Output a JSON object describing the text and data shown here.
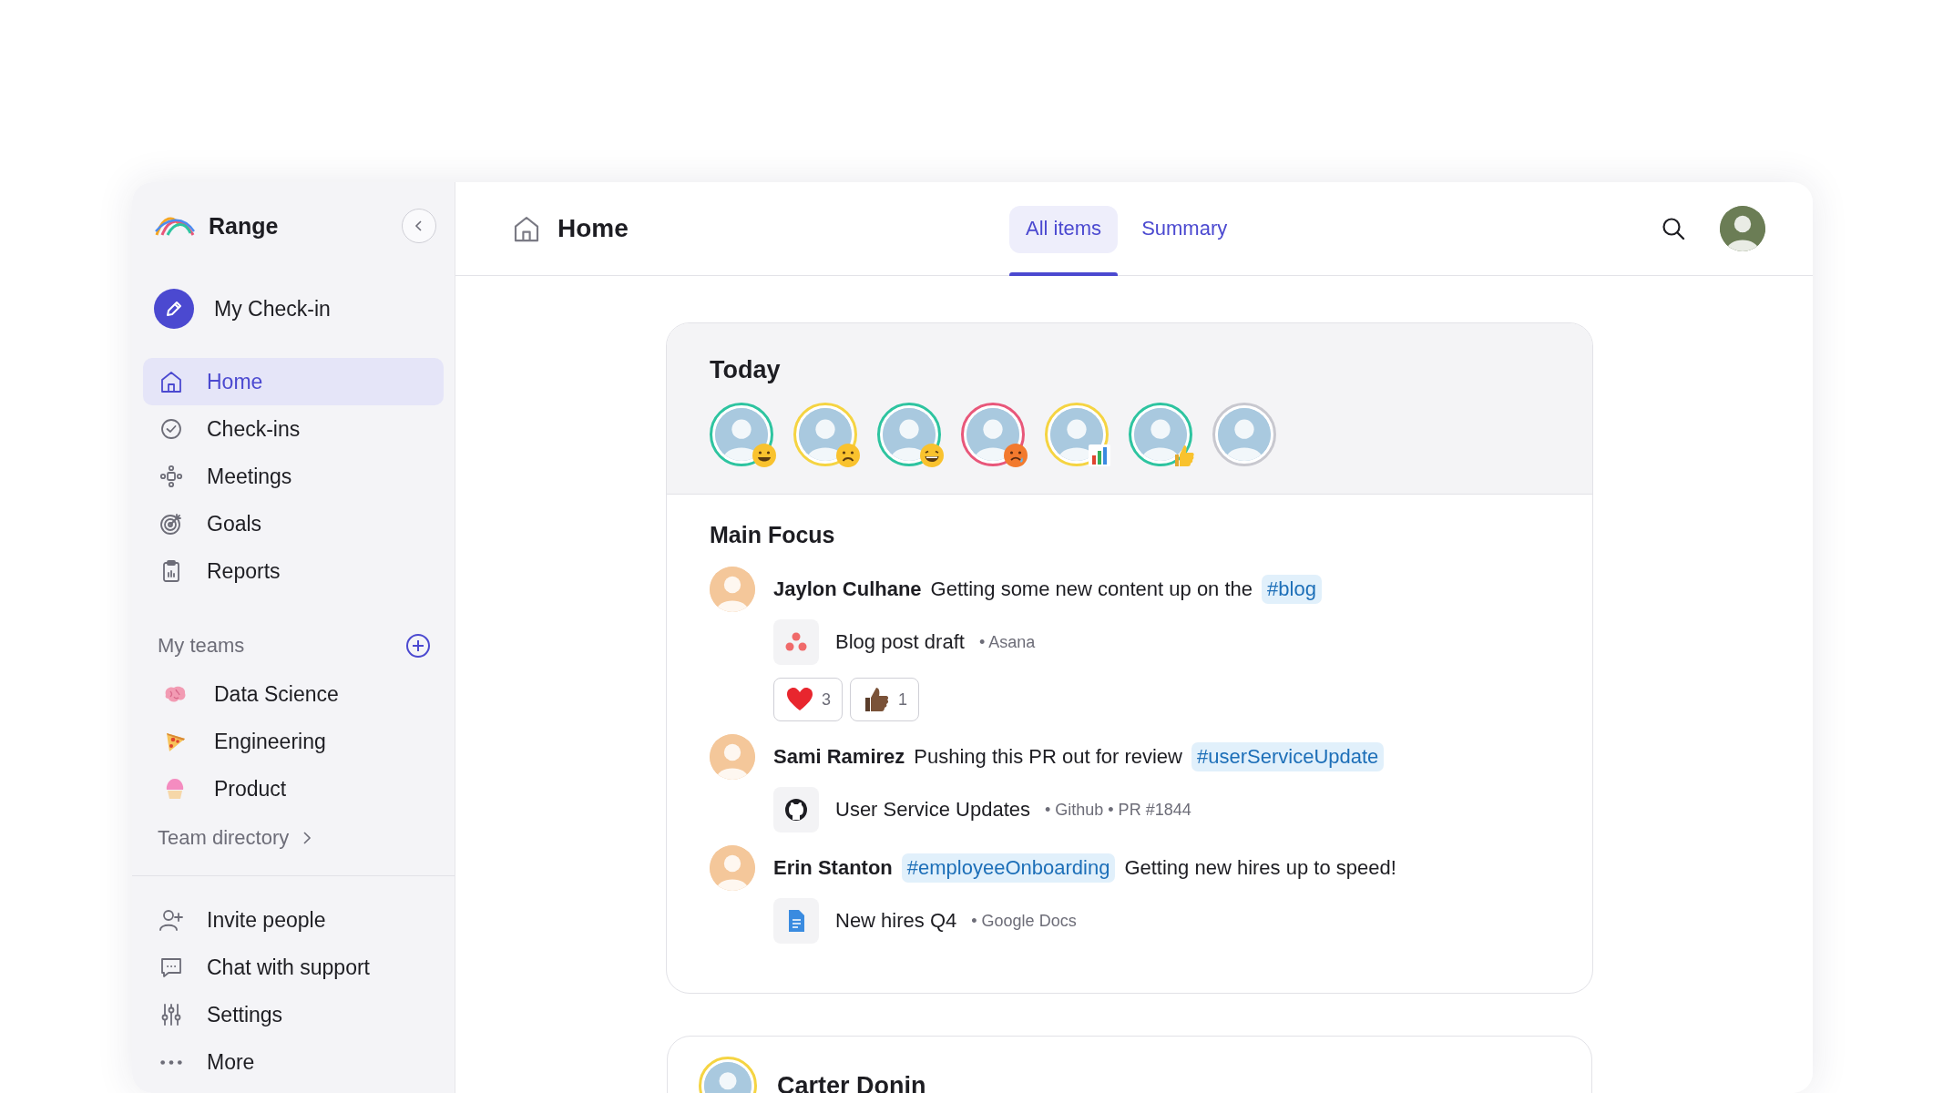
{
  "sidebar": {
    "brand": "Range",
    "my_checkin": "My Check-in",
    "nav": [
      {
        "label": "Home",
        "selected": true
      },
      {
        "label": "Check-ins",
        "selected": false
      },
      {
        "label": "Meetings",
        "selected": false
      },
      {
        "label": "Goals",
        "selected": false
      },
      {
        "label": "Reports",
        "selected": false
      }
    ],
    "teams_heading": "My teams",
    "teams": [
      {
        "label": "Data Science"
      },
      {
        "label": "Engineering"
      },
      {
        "label": "Product"
      }
    ],
    "team_directory": "Team directory",
    "footer": [
      {
        "label": "Invite people"
      },
      {
        "label": "Chat with support"
      },
      {
        "label": "Settings"
      },
      {
        "label": "More"
      }
    ]
  },
  "header": {
    "title": "Home",
    "tabs": [
      {
        "label": "All items",
        "selected": true
      },
      {
        "label": "Summary",
        "selected": false
      }
    ]
  },
  "today": {
    "title": "Today",
    "people": [
      {
        "color": "#2ec4a0"
      },
      {
        "color": "#f5d442"
      },
      {
        "color": "#2ec4a0"
      },
      {
        "color": "#e8577a"
      },
      {
        "color": "#f5d442"
      },
      {
        "color": "#2ec4a0"
      },
      {
        "color": "#c8c8cf"
      }
    ]
  },
  "main_focus": {
    "title": "Main Focus",
    "posts": [
      {
        "author": "Jaylon Culhane",
        "parts": [
          {
            "kind": "text",
            "text": "Getting some new content up on the"
          },
          {
            "kind": "tag",
            "text": "#blog"
          }
        ],
        "attachment": {
          "title": "Blog post draft",
          "meta": "• Asana"
        },
        "reactions": [
          {
            "kind": "heart",
            "count": "3"
          },
          {
            "kind": "thumbs",
            "count": "1"
          }
        ]
      },
      {
        "author": "Sami Ramirez",
        "parts": [
          {
            "kind": "text",
            "text": "Pushing this PR out for review"
          },
          {
            "kind": "tag",
            "text": "#userServiceUpdate"
          }
        ],
        "attachment": {
          "title": "User Service Updates",
          "meta": "• Github • PR #1844"
        }
      },
      {
        "author": "Erin Stanton",
        "parts": [
          {
            "kind": "tag",
            "text": "#employeeOnboarding"
          },
          {
            "kind": "text",
            "text": "Getting new hires up to speed!"
          }
        ],
        "attachment": {
          "title": "New hires Q4",
          "meta": "• Google Docs"
        }
      }
    ]
  },
  "next_card": {
    "author": "Carter Donin",
    "color": "#f5d442"
  }
}
